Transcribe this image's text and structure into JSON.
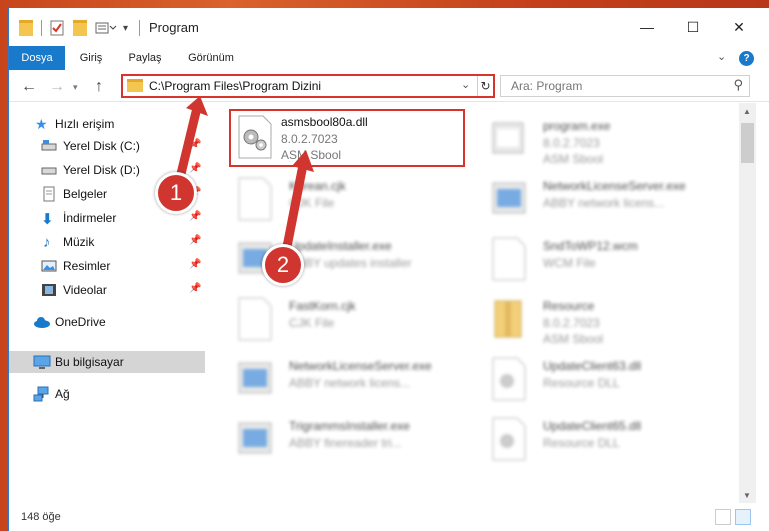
{
  "window": {
    "title": "Program",
    "minimize": "—",
    "maximize": "☐",
    "close": "✕"
  },
  "ribbon": {
    "tabs": [
      {
        "label": "Dosya"
      },
      {
        "label": "Giriş"
      },
      {
        "label": "Paylaş"
      },
      {
        "label": "Görünüm"
      }
    ],
    "help": "?"
  },
  "nav": {
    "address_path": "C:\\Program Files\\Program Dizini",
    "search_placeholder": "Ara: Program"
  },
  "sidebar": {
    "items": [
      {
        "label": "Hızlı erişim",
        "icon": "star-icon"
      },
      {
        "label": "Yerel Disk (C:)",
        "icon": "drive-icon"
      },
      {
        "label": "Yerel Disk (D:)",
        "icon": "drive-icon"
      },
      {
        "label": "Belgeler",
        "icon": "documents-icon"
      },
      {
        "label": "İndirmeler",
        "icon": "download-icon"
      },
      {
        "label": "Müzik",
        "icon": "music-icon"
      },
      {
        "label": "Resimler",
        "icon": "pictures-icon"
      },
      {
        "label": "Videolar",
        "icon": "videos-icon"
      },
      {
        "label": "OneDrive",
        "icon": "cloud-icon"
      },
      {
        "label": "Bu bilgisayar",
        "icon": "computer-icon"
      },
      {
        "label": "Ağ",
        "icon": "network-icon"
      }
    ]
  },
  "files": [
    {
      "name": "asmsbool80a.dll",
      "line2": "8.0.2.7023",
      "line3": "ASM Sbool",
      "highlighted": true
    },
    {
      "name": "program.exe",
      "line2": "8.0.2.7023",
      "line3": "ASM Sbool"
    },
    {
      "name": "Korean.cjk",
      "line2": "CJK File",
      "line3": ""
    },
    {
      "name": "NetworkLicenseServer.exe",
      "line2": "ABBY network licens...",
      "line3": ""
    },
    {
      "name": "UpdateInstaller.exe",
      "line2": "ABBY updates installer",
      "line3": ""
    },
    {
      "name": "SndToWP12.wcm",
      "line2": "WCM File",
      "line3": ""
    },
    {
      "name": "FastKorn.cjk",
      "line2": "CJK File",
      "line3": ""
    },
    {
      "name": "Resource",
      "line2": "8.0.2.7023",
      "line3": "ASM Sbool"
    },
    {
      "name": "NetworkLicenseServer.exe",
      "line2": "ABBY network licens...",
      "line3": ""
    },
    {
      "name": "UpdateClient63.dll",
      "line2": "Resource DLL",
      "line3": ""
    },
    {
      "name": "TrigrammsInstaller.exe",
      "line2": "ABBY finereader tri...",
      "line3": ""
    },
    {
      "name": "UpdateClient65.dll",
      "line2": "Resource DLL",
      "line3": ""
    }
  ],
  "status": {
    "item_count": "148 öğe"
  },
  "annotations": {
    "badge1": "1",
    "badge2": "2"
  },
  "colors": {
    "accent": "#1979ca",
    "highlight": "#d9342b"
  }
}
